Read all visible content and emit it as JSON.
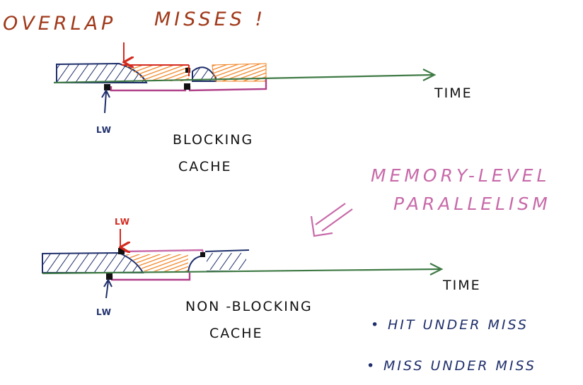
{
  "title": {
    "overlap": "OVERLAP",
    "misses": "MISSES !"
  },
  "blocking": {
    "time_label": "TIME",
    "lw_label": "LW",
    "caption_line1": "BLOCKING",
    "caption_line2": "CACHE"
  },
  "nonblocking": {
    "time_label": "TIME",
    "lw_top_label": "LW",
    "lw_bottom_label": "LW",
    "caption_line1": "NON -BLOCKING",
    "caption_line2": "CACHE"
  },
  "mlp": {
    "line1": "MEMORY-LEVEL",
    "line2": "PARALLELISM"
  },
  "bullets": [
    {
      "marker": "•",
      "text": "HIT UNDER MISS"
    },
    {
      "marker": "•",
      "text": "MISS UNDER MISS"
    }
  ],
  "colors": {
    "title": "#a0391a",
    "axis": "#3f7a45",
    "navy": "#1f2f6b",
    "red": "#d42a1e",
    "orange": "#f07f1a",
    "magenta": "#b0418a",
    "mlp": "#c86aa9",
    "black": "#111111"
  }
}
